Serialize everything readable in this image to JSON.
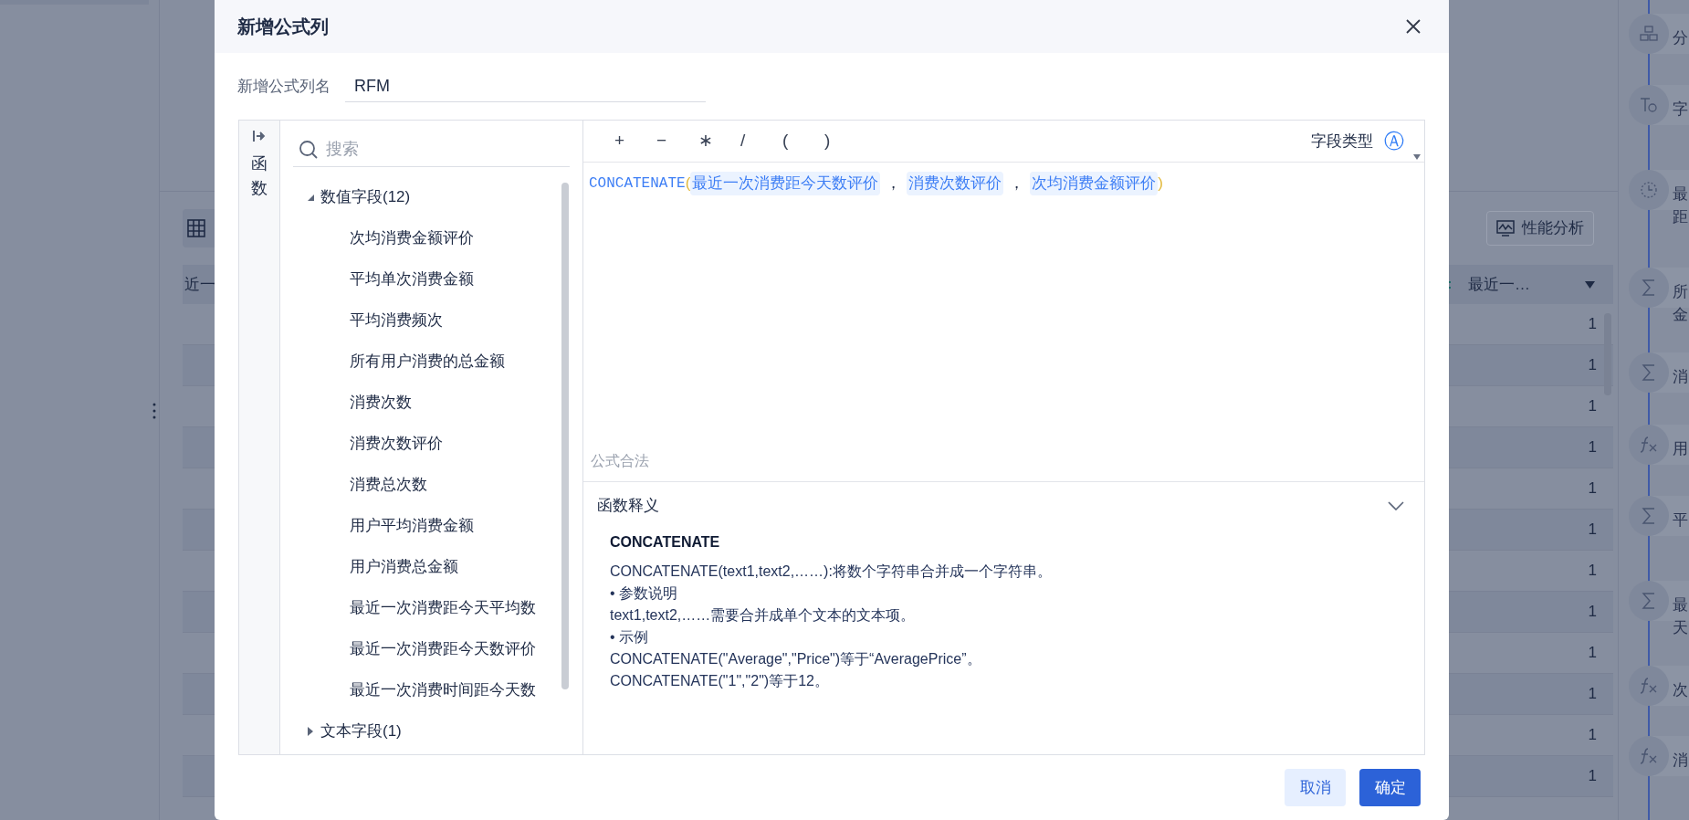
{
  "background": {
    "left_table_header": "近一",
    "performance_button": "性能分析",
    "column_header": "最近一…",
    "column_values": [
      "1",
      "1",
      "1",
      "1",
      "1",
      "1",
      "1",
      "1",
      "1",
      "1",
      "1",
      "1"
    ],
    "side_items": [
      {
        "kind": "group",
        "label": "分"
      },
      {
        "kind": "text",
        "label": "字"
      },
      {
        "kind": "clock",
        "label": "最距"
      },
      {
        "kind": "sum",
        "label": "所金"
      },
      {
        "kind": "sum",
        "label": "消"
      },
      {
        "kind": "fx",
        "label": "用"
      },
      {
        "kind": "sum",
        "label": "平"
      },
      {
        "kind": "sum",
        "label": "最天"
      },
      {
        "kind": "fx",
        "label": "次"
      },
      {
        "kind": "fx",
        "label": "消"
      }
    ]
  },
  "dialog": {
    "title": "新增公式列",
    "name_label": "新增公式列名",
    "name_value": "RFM",
    "sidebar_tab": "函数",
    "search": {
      "placeholder": "搜索"
    },
    "field_tree": [
      {
        "label": "数值字段(12)",
        "expanded": true,
        "children": [
          {
            "label": "次均消费金额评价"
          },
          {
            "label": "平均单次消费金额"
          },
          {
            "label": "平均消费频次"
          },
          {
            "label": "所有用户消费的总金额"
          },
          {
            "label": "消费次数"
          },
          {
            "label": "消费次数评价"
          },
          {
            "label": "消费总次数"
          },
          {
            "label": "用户平均消费金额"
          },
          {
            "label": "用户消费总金额"
          },
          {
            "label": "最近一次消费距今天平均数"
          },
          {
            "label": "最近一次消费距今天数评价"
          },
          {
            "label": "最近一次消费时间距今天数"
          }
        ]
      },
      {
        "label": "文本字段(1)",
        "expanded": false
      }
    ],
    "operators": [
      "+",
      "−",
      "∗",
      "/",
      "(",
      ")"
    ],
    "field_type_label": "字段类型",
    "field_type_symbol": "Ⓐ",
    "formula": [
      {
        "kind": "function",
        "text": "CONCATENATE"
      },
      {
        "kind": "paren",
        "text": "("
      },
      {
        "kind": "field",
        "text": "最近一次消费距今天数评价"
      },
      {
        "kind": "separator",
        "text": "，"
      },
      {
        "kind": "field",
        "text": "消费次数评价"
      },
      {
        "kind": "separator",
        "text": "，"
      },
      {
        "kind": "field",
        "text": "次均消费金额评价"
      },
      {
        "kind": "paren",
        "text": ")"
      }
    ],
    "validation": "公式合法",
    "explanation": {
      "heading": "函数释义",
      "expanded": true,
      "title": "CONCATENATE",
      "lines": [
        "CONCATENATE(text1,text2,……):将数个字符串合并成一个字符串。",
        "• 参数说明",
        "text1,text2,……需要合并成单个文本的文本项。",
        "• 示例",
        "CONCATENATE(\"Average\",\"Price\")等于“AveragePrice”。",
        "CONCATENATE(\"1\",\"2\")等于12。"
      ]
    },
    "buttons": [
      {
        "label": "取消",
        "kind": "secondary"
      },
      {
        "label": "确定",
        "kind": "primary"
      }
    ]
  }
}
